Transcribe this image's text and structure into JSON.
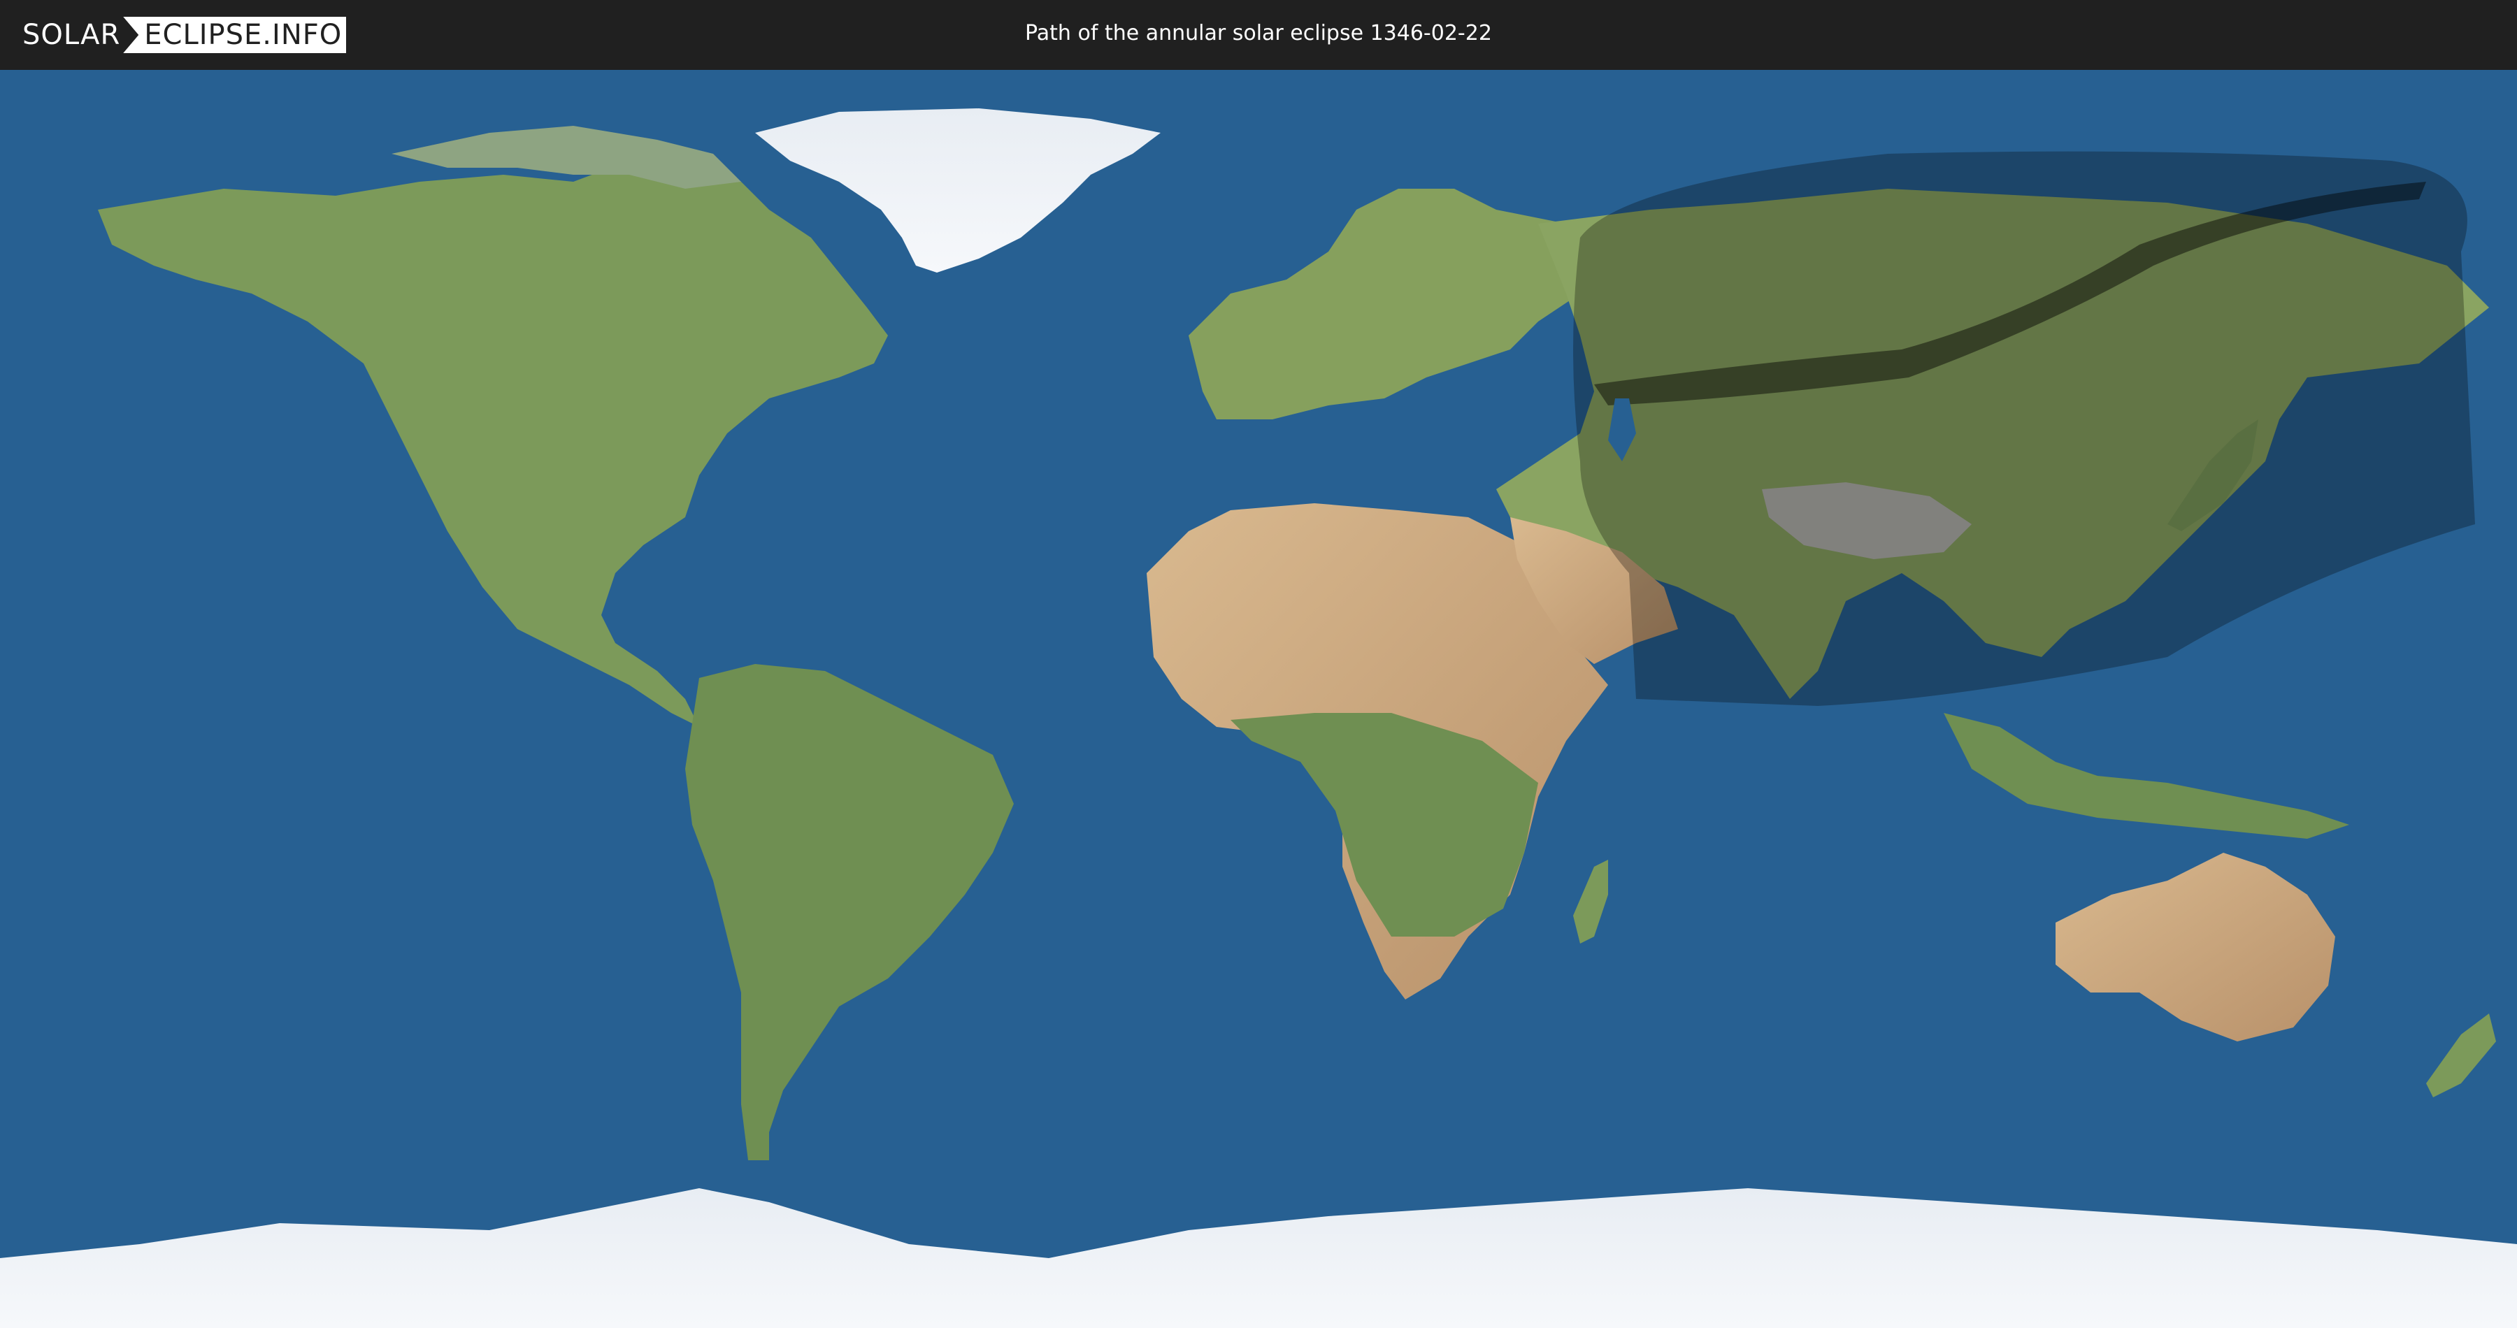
{
  "header": {
    "logo_part1": "SOLAR",
    "logo_part2": "ECLIPSE.INFO",
    "title": "Path of the annular solar eclipse 1346-02-22"
  },
  "map": {
    "projection": "equirectangular",
    "ocean_color": "#276092",
    "land_color": "#7e9a58",
    "desert_color": "#c9a67d",
    "ice_color": "#eef2f7",
    "penumbra_color": "#000000",
    "annular_path_color": "#000000"
  }
}
